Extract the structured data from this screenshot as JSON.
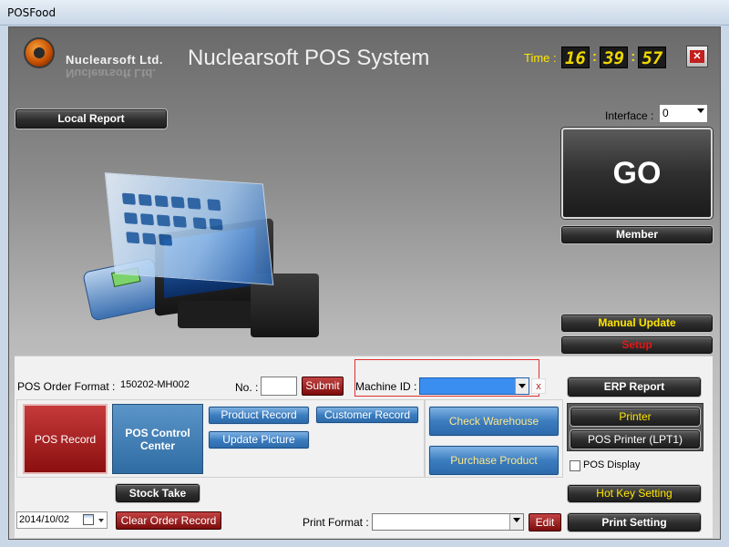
{
  "window": {
    "title": "POSFood"
  },
  "header": {
    "company": "Nuclearsoft Ltd.",
    "app_title": "Nuclearsoft POS System",
    "time_label": "Time :",
    "time": {
      "hh": "16",
      "mm": "39",
      "ss": "57"
    },
    "close_icon": "close-icon"
  },
  "left": {
    "local_report": "Local Report"
  },
  "right": {
    "interface_label": "Interface :",
    "interface_value": "0",
    "go": "GO",
    "member": "Member",
    "manual_update": "Manual Update",
    "setup": "Setup"
  },
  "order": {
    "format_label": "POS Order Format :",
    "format_value": "150202-MH002",
    "no_label": "No. :",
    "no_value": "",
    "submit": "Submit",
    "machine_label": "Machine ID :",
    "machine_value": "",
    "clear_x": "x",
    "erp_report": "ERP Report"
  },
  "records": {
    "pos_record": "POS Record",
    "pos_control_center": "POS Control Center",
    "product_record": "Product Record",
    "update_picture": "Update Picture",
    "customer_record": "Customer Record",
    "check_warehouse": "Check Warehouse",
    "purchase_product": "Purchase Product",
    "printer": "Printer",
    "pos_printer": "POS Printer (LPT1)",
    "pos_display": "POS Display",
    "stock_take": "Stock Take",
    "hot_key_setting": "Hot Key Setting"
  },
  "footer": {
    "date": "2014/10/02",
    "clear_order_record": "Clear Order Record",
    "print_format_label": "Print Format :",
    "print_format_value": "",
    "edit": "Edit",
    "print_setting": "Print Setting"
  },
  "colors": {
    "accent_yellow": "#ffe600",
    "setup_red": "#e01818",
    "record_red": "#a01818",
    "tile_blue": "#2e6ca3"
  }
}
